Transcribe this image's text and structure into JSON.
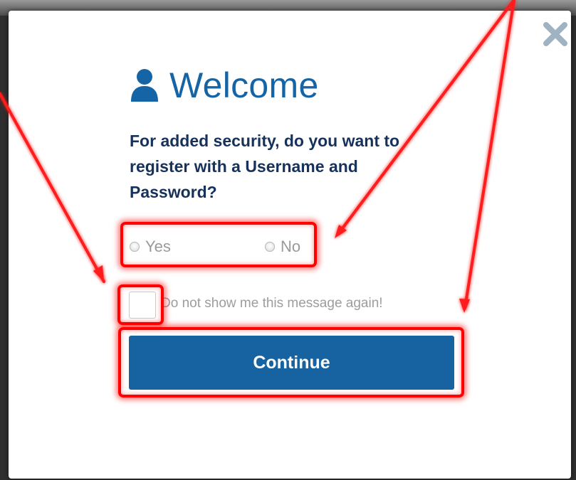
{
  "modal": {
    "title": "Welcome",
    "question": "For added security, do you want to register with a Username and Password?",
    "options": [
      "Yes",
      "No"
    ],
    "checkbox_label": "Do not show me this message again!",
    "continue_label": "Continue"
  },
  "icons": {
    "title_icon": "user-icon",
    "close_icon": "close-icon"
  },
  "colors": {
    "primary_blue": "#1762a1",
    "heading_navy": "#17325a",
    "annotation_red": "#ff0000"
  }
}
